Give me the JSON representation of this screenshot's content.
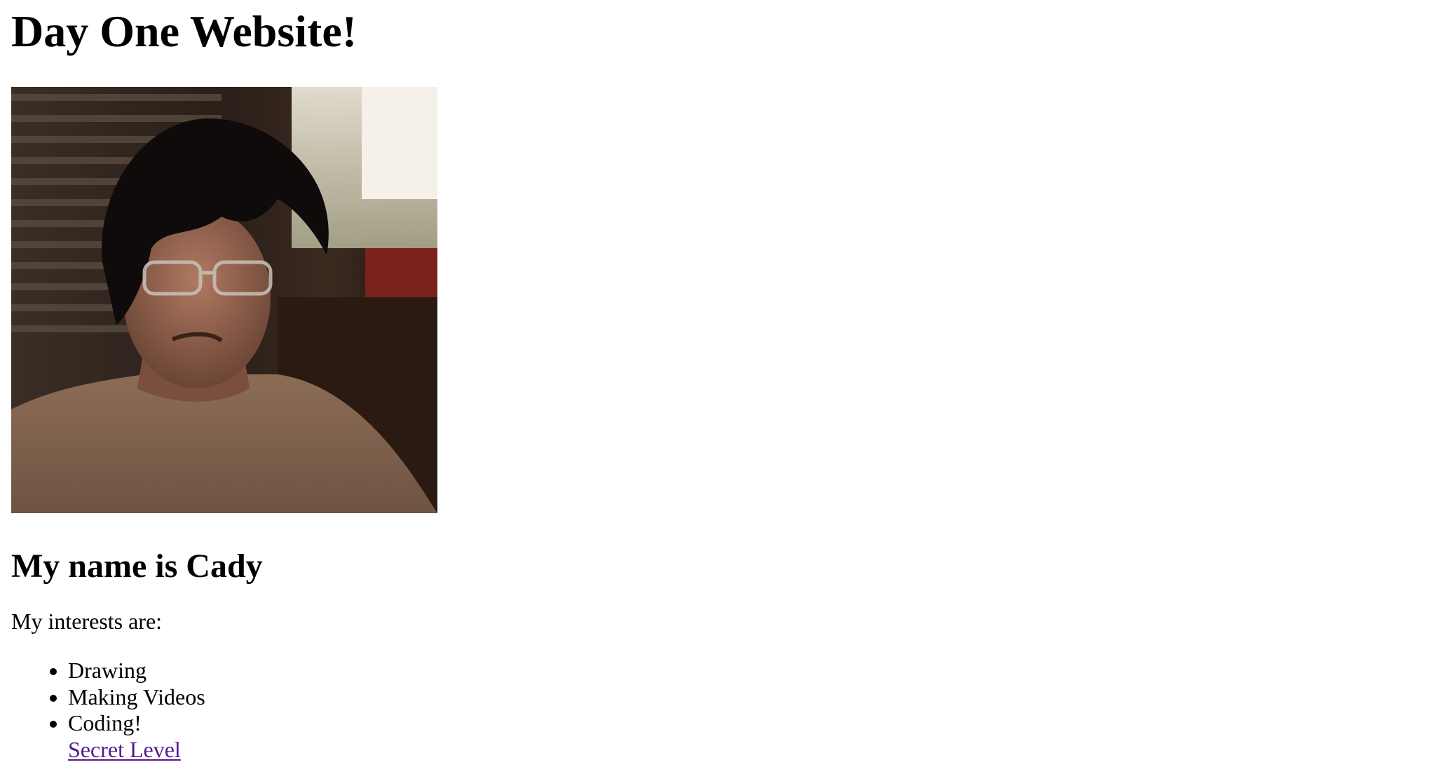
{
  "page": {
    "title": "Day One Website!",
    "photo_alt": "Portrait photo of Cady",
    "name_heading": "My name is Cady",
    "interests_intro": "My interests are:",
    "interests": [
      "Drawing",
      "Making Videos",
      "Coding!"
    ],
    "secret_link_label": "Secret Level"
  },
  "colors": {
    "link_visited": "#551a8b",
    "text": "#000000",
    "background": "#ffffff"
  }
}
